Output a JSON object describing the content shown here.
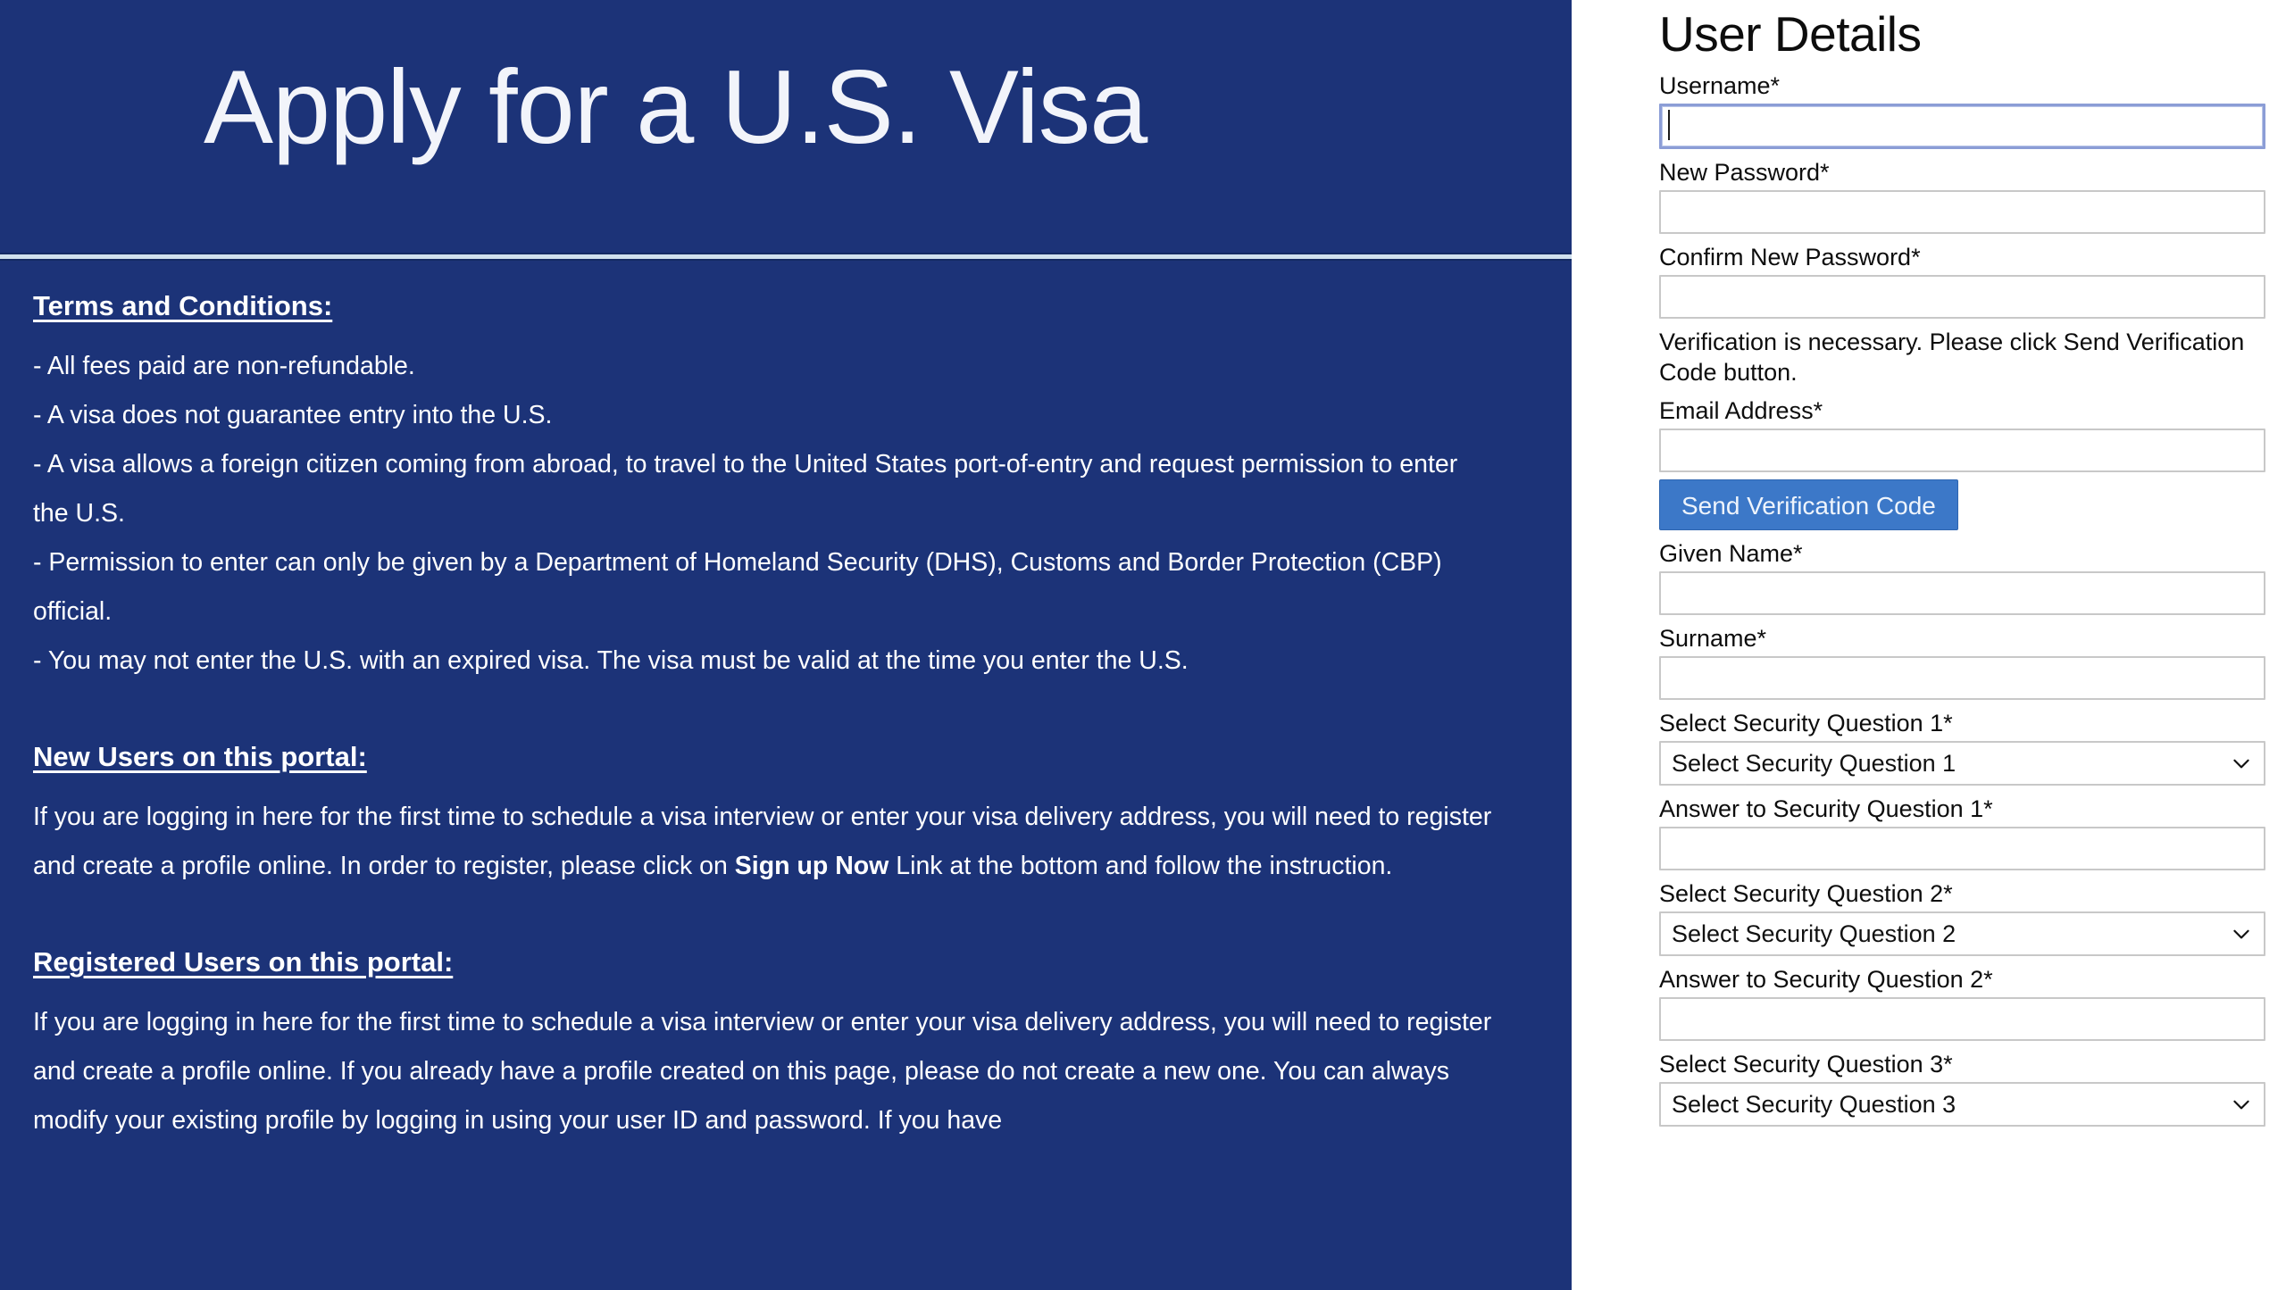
{
  "banner": {
    "title": "Apply for a U.S. Visa"
  },
  "terms": {
    "heading": "Terms and Conditions:",
    "items": [
      "- All fees paid are non-refundable.",
      "- A visa does not guarantee entry into the U.S.",
      "- A visa allows a foreign citizen coming from abroad, to travel to the United States port-of-entry and request permission to enter the U.S.",
      "- Permission to enter can only be given by a Department of Homeland Security (DHS), Customs and Border Protection (CBP) official.",
      "- You may not enter the U.S. with an expired visa. The visa must be valid at the time you enter the U.S."
    ]
  },
  "new_users": {
    "heading": "New Users on this portal:",
    "text_before_link": "If you are logging in here for the first time to schedule a visa interview or enter your visa delivery address, you will need to register and create a profile online. In order to register, please click on ",
    "link_label": "Sign up Now",
    "text_after_link": " Link at the bottom and follow the instruction."
  },
  "registered_users": {
    "heading": "Registered Users on this portal:",
    "text": "If you are logging in here for the first time to schedule a visa interview or enter your visa delivery address, you will need to register and create a profile online. If you already have a profile created on this page, please do not create a new one. You can always modify your existing profile by logging in using your user ID and password. If you have"
  },
  "form": {
    "title": "User Details",
    "username": {
      "label": "Username*",
      "value": "",
      "placeholder": ""
    },
    "new_password": {
      "label": "New Password*",
      "value": "",
      "placeholder": ""
    },
    "confirm_password": {
      "label": "Confirm New Password*",
      "value": "",
      "placeholder": ""
    },
    "verification_note": "Verification is necessary. Please click Send Verification Code button.",
    "email": {
      "label": "Email Address*",
      "value": "",
      "placeholder": ""
    },
    "send_code_button": "Send Verification Code",
    "given_name": {
      "label": "Given Name*",
      "value": "",
      "placeholder": ""
    },
    "surname": {
      "label": "Surname*",
      "value": "",
      "placeholder": ""
    },
    "security_question_1": {
      "label": "Select Security Question 1*",
      "selected": "Select Security Question 1"
    },
    "answer_1": {
      "label": "Answer to Security Question 1*",
      "value": "",
      "placeholder": ""
    },
    "security_question_2": {
      "label": "Select Security Question 2*",
      "selected": "Select Security Question 2"
    },
    "answer_2": {
      "label": "Answer to Security Question 2*",
      "value": "",
      "placeholder": ""
    },
    "security_question_3": {
      "label": "Select Security Question 3*",
      "selected": "Select Security Question 3"
    }
  },
  "colors": {
    "panel_blue": "#1c3378",
    "button_blue": "#3c78c8",
    "divider": "#cfe0ee",
    "focus_border": "#8b9dd6"
  }
}
